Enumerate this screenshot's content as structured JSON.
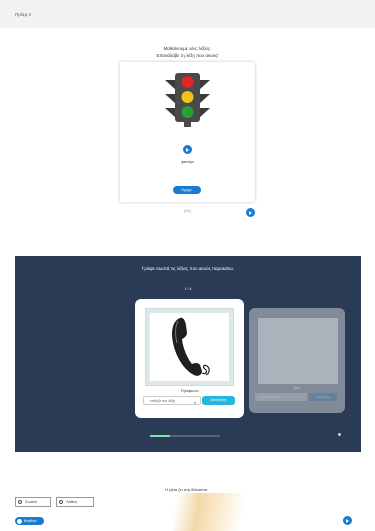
{
  "topbar": {
    "crumb": "Πρίσμ 4"
  },
  "section1": {
    "title_line1": "Μαθαίνουμε νέες λέξεις.",
    "title_line2": "Επανάλαβε τη λέξη που ακούς!",
    "word": "φανάρι",
    "record_button": "Ηχογρ.",
    "below_card": "(0/0)",
    "traffic_light_colors": [
      "#e22424",
      "#f2c21b",
      "#2a9d3a"
    ]
  },
  "section2": {
    "title": "Γράψε σωστά τις λέξεις που ακούς παρακάτω.",
    "counter": "1 / 4",
    "card_label": "Τηλέφωνο",
    "select_placeholder": "επίλεξε την λέξη",
    "check_button": "Απάντηση",
    "card2_label": "Ώρα",
    "card2_select": "επίλεξε την λέξη",
    "card2_check": "Απάντηση",
    "progress": 0.28
  },
  "section3": {
    "question": "Η γάτα ζει στη θάλασσα.",
    "options": [
      "Σωστό",
      "Λάθος"
    ],
    "help_button": "Βοήθεια"
  },
  "colors": {
    "accent": "#1a7bd1",
    "dark_bg": "#2b3a55",
    "check": "#24b6dd"
  }
}
